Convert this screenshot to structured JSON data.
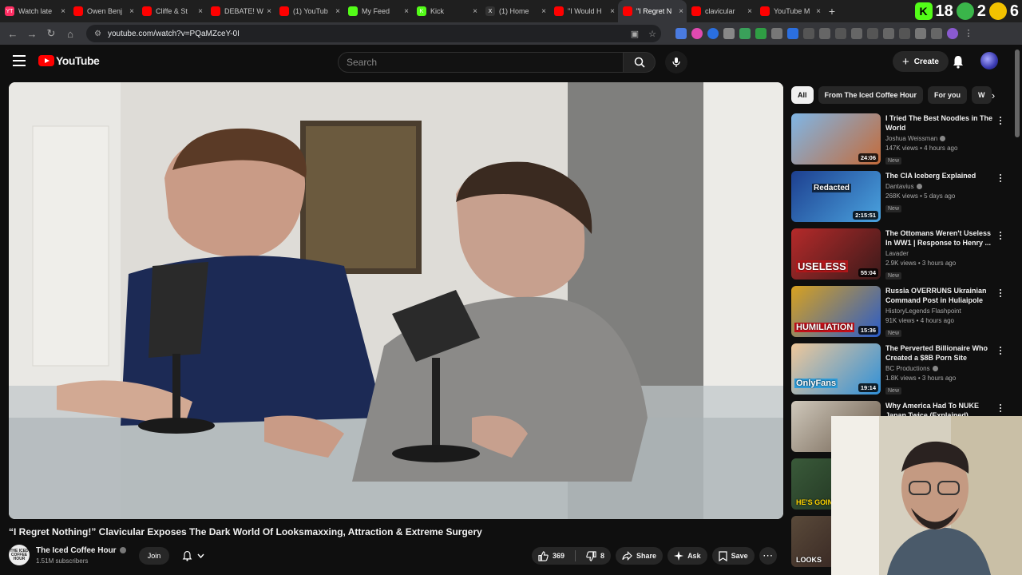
{
  "browser": {
    "tabs": [
      {
        "title": "Watch late",
        "fav_color": "#ff2e63",
        "fav_text": "YT",
        "active": false
      },
      {
        "title": "Owen Benj",
        "fav_color": "#ff0000",
        "fav_text": "",
        "active": false
      },
      {
        "title": "Cliffe & St",
        "fav_color": "#ff0000",
        "fav_text": "",
        "active": false
      },
      {
        "title": "DEBATE! W",
        "fav_color": "#ff0000",
        "fav_text": "",
        "active": false
      },
      {
        "title": "(1) YouTub",
        "fav_color": "#ff0000",
        "fav_text": "",
        "active": false
      },
      {
        "title": "My Feed",
        "fav_color": "#53fc18",
        "fav_text": "",
        "active": false
      },
      {
        "title": "Kick",
        "fav_color": "#53fc18",
        "fav_text": "K",
        "active": false
      },
      {
        "title": "(1) Home",
        "fav_color": "#333333",
        "fav_text": "X",
        "active": false
      },
      {
        "title": "\"I Would H",
        "fav_color": "#ff0000",
        "fav_text": "",
        "active": false
      },
      {
        "title": "\"I Regret N",
        "fav_color": "#ff0000",
        "fav_text": "",
        "active": true
      },
      {
        "title": "clavicular",
        "fav_color": "#ff0000",
        "fav_text": "",
        "active": false
      },
      {
        "title": "YouTube M",
        "fav_color": "#ff0000",
        "fav_text": "",
        "active": false
      }
    ],
    "new_tab_label": "+",
    "top_right": {
      "kick_letter": "K",
      "count_a": "18",
      "count_b": "2",
      "count_c": "6"
    },
    "url": "youtube.com/watch?v=PQaMZceY-0I"
  },
  "youtube": {
    "logo_text": "YouTube",
    "search_placeholder": "Search",
    "create_label": "Create",
    "video": {
      "title": "“I Regret Nothing!” Clavicular Exposes The Dark World Of Looksmaxxing, Attraction & Extreme Surgery",
      "channel": "The Iced Coffee Hour",
      "channel_avatar_text": "THE ICED COFFEE HOUR",
      "subscribers": "1.51M subscribers",
      "join_label": "Join",
      "likes": "369",
      "dislikes": "8",
      "share_label": "Share",
      "ask_label": "Ask",
      "save_label": "Save"
    },
    "chips": [
      {
        "label": "All",
        "active": true
      },
      {
        "label": "From The Iced Coffee Hour",
        "active": false
      },
      {
        "label": "For you",
        "active": false
      },
      {
        "label": "W",
        "active": false
      }
    ],
    "recommendations": [
      {
        "title": "I Tried The Best Noodles in The World",
        "channel": "Joshua Weissman",
        "verified": true,
        "meta": "147K views • 4 hours ago",
        "badge": "New",
        "duration": "24:06",
        "thumb_text": "",
        "thumb_colors": [
          "#7fb6e6",
          "#c46b3a"
        ]
      },
      {
        "title": "The CIA Iceberg Explained",
        "channel": "Dantavius",
        "verified": true,
        "meta": "268K views • 5 days ago",
        "badge": "New",
        "duration": "2:15:51",
        "thumb_text": "Redacted",
        "thumb_colors": [
          "#1d3f8f",
          "#4aa3df"
        ]
      },
      {
        "title": "The Ottomans Weren't Useless In WW1 | Response to Henry ...",
        "channel": "Lavader",
        "verified": false,
        "meta": "2.9K views • 3 hours ago",
        "badge": "New",
        "duration": "55:04",
        "thumb_text": "USELESS",
        "thumb_colors": [
          "#b52a2a",
          "#3a1a1a"
        ]
      },
      {
        "title": "Russia OVERRUNS Ukrainian Command Post in Huliaipole",
        "channel": "HistoryLegends Flashpoint",
        "verified": false,
        "meta": "91K views • 4 hours ago",
        "badge": "New",
        "duration": "15:36",
        "thumb_text": "HUMILIATION",
        "thumb_colors": [
          "#d9a21f",
          "#2a5cc9"
        ]
      },
      {
        "title": "The Perverted Billionaire Who Created a $8B Porn Site",
        "channel": "BC Productions",
        "verified": true,
        "meta": "1.8K views • 3 hours ago",
        "badge": "New",
        "duration": "19:14",
        "thumb_text": "OnlyFans",
        "thumb_colors": [
          "#f0c89a",
          "#2f90d8"
        ]
      },
      {
        "title": "Why America Had To NUKE Japan Twice (Explained)",
        "channel": "",
        "verified": false,
        "meta": "",
        "badge": "",
        "duration": "",
        "thumb_text": "",
        "thumb_colors": [
          "#cfc8bb",
          "#6a5a4a"
        ]
      },
      {
        "title": "",
        "channel": "",
        "verified": false,
        "meta": "",
        "badge": "",
        "duration": "",
        "thumb_text": "HE'S GOIN",
        "thumb_colors": [
          "#3a5a3a",
          "#1a2a1a"
        ]
      },
      {
        "title": "",
        "channel": "",
        "verified": false,
        "meta": "",
        "badge": "",
        "duration": "",
        "thumb_text": "LOOKS",
        "thumb_colors": [
          "#5a4a3a",
          "#2a1a1a"
        ]
      }
    ]
  },
  "colors": {
    "background": "#0f0f0f",
    "surface": "#272727",
    "brand_red": "#ff0000",
    "text_primary": "#f1f1f1",
    "text_secondary": "#aaaaaa"
  }
}
